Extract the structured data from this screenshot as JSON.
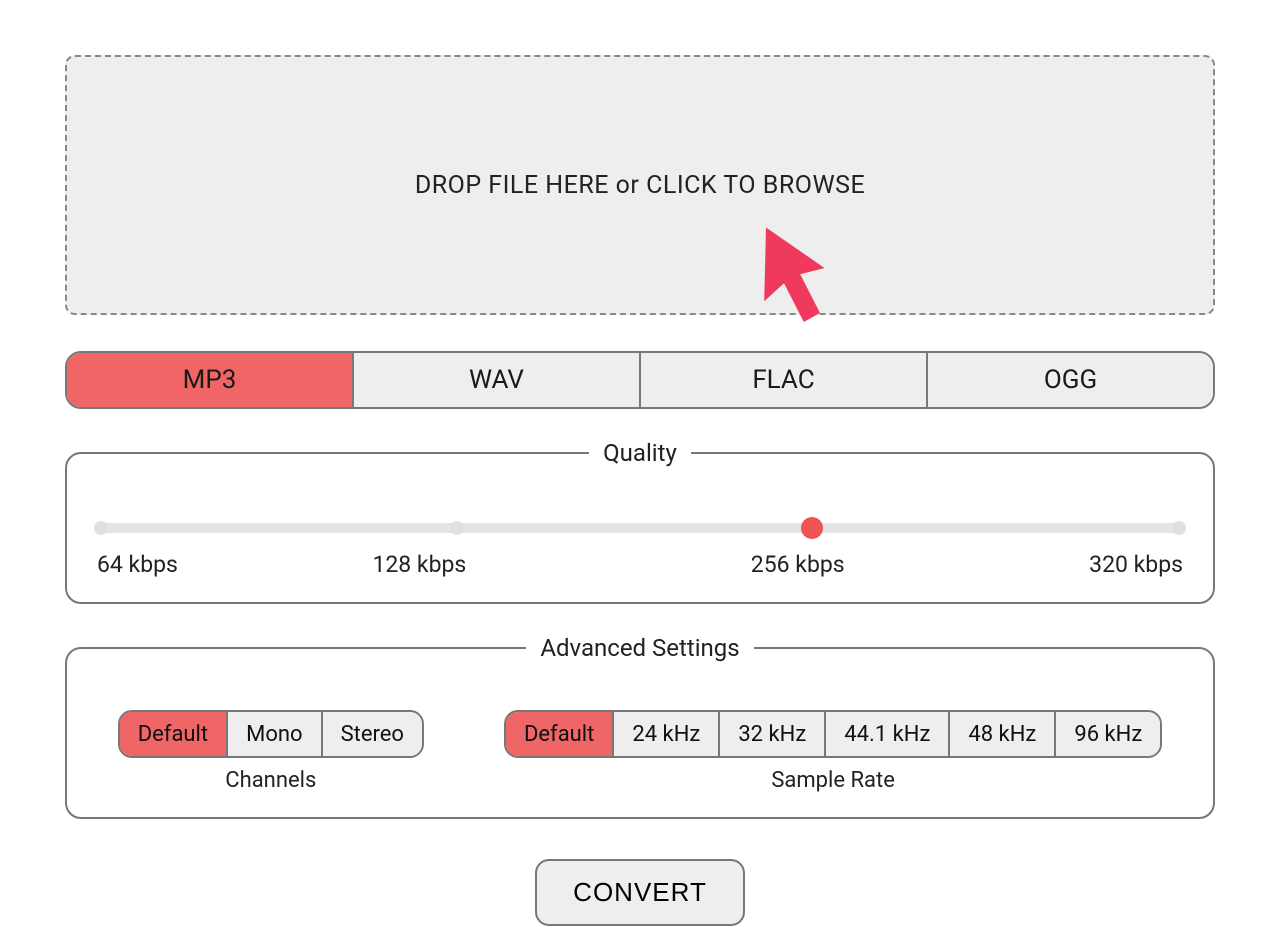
{
  "dropzone": {
    "label": "DROP FILE HERE or CLICK TO BROWSE"
  },
  "formats": {
    "items": [
      {
        "label": "MP3",
        "selected": true
      },
      {
        "label": "WAV",
        "selected": false
      },
      {
        "label": "FLAC",
        "selected": false
      },
      {
        "label": "OGG",
        "selected": false
      }
    ]
  },
  "quality": {
    "legend": "Quality",
    "stops": [
      {
        "label": "64 kbps",
        "pos": 0
      },
      {
        "label": "128 kbps",
        "pos": 33
      },
      {
        "label": "256 kbps",
        "pos": 66
      },
      {
        "label": "320 kbps",
        "pos": 100
      }
    ],
    "selected_index": 2
  },
  "advanced": {
    "legend": "Advanced Settings",
    "channels": {
      "caption": "Channels",
      "items": [
        {
          "label": "Default",
          "selected": true
        },
        {
          "label": "Mono",
          "selected": false
        },
        {
          "label": "Stereo",
          "selected": false
        }
      ]
    },
    "sample_rate": {
      "caption": "Sample Rate",
      "items": [
        {
          "label": "Default",
          "selected": true
        },
        {
          "label": "24 kHz",
          "selected": false
        },
        {
          "label": "32 kHz",
          "selected": false
        },
        {
          "label": "44.1 kHz",
          "selected": false
        },
        {
          "label": "48 kHz",
          "selected": false
        },
        {
          "label": "96 kHz",
          "selected": false
        }
      ]
    }
  },
  "convert": {
    "label": "CONVERT"
  },
  "colors": {
    "accent": "#f06565",
    "panel_border": "#777",
    "fill": "#eeeeee"
  }
}
